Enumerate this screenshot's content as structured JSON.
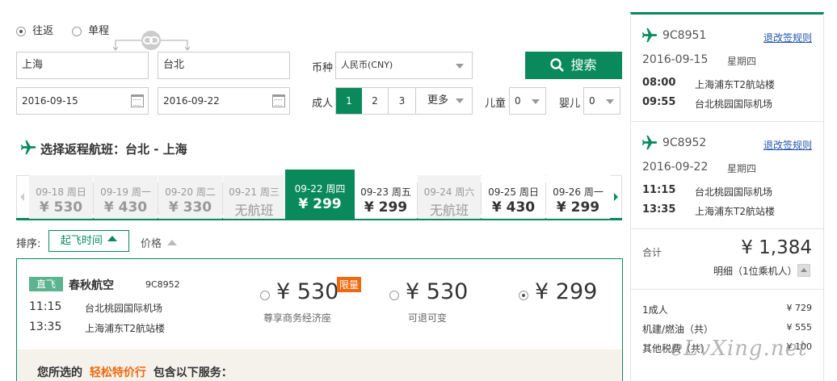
{
  "trip": {
    "roundtrip": "往返",
    "oneway": "单程"
  },
  "search": {
    "from": "上海",
    "to": "台北",
    "depart_date": "2016-09-15",
    "return_date": "2016-09-22",
    "currency_label": "币种",
    "currency": "人民币(CNY)",
    "adult_label": "成人",
    "adult_options": [
      "1",
      "2",
      "3"
    ],
    "more": "更多",
    "child_label": "儿童",
    "child_value": "0",
    "infant_label": "婴儿",
    "infant_value": "0",
    "search_button": "搜索"
  },
  "section_title": "选择返程航班：台北 - 上海",
  "date_tabs": [
    {
      "date": "09-18",
      "weekday": "周日",
      "price": "¥ 530",
      "state": "gray"
    },
    {
      "date": "09-19",
      "weekday": "周一",
      "price": "¥ 430",
      "state": "gray"
    },
    {
      "date": "09-20",
      "weekday": "周二",
      "price": "¥ 330",
      "state": "gray"
    },
    {
      "date": "09-21",
      "weekday": "周三",
      "price": "无航班",
      "state": "gray"
    },
    {
      "date": "09-22",
      "weekday": "周四",
      "price": "¥ 299",
      "state": "selected"
    },
    {
      "date": "09-23",
      "weekday": "周五",
      "price": "¥ 299",
      "state": "normal"
    },
    {
      "date": "09-24",
      "weekday": "周六",
      "price": "无航班",
      "state": "gray"
    },
    {
      "date": "09-25",
      "weekday": "周日",
      "price": "¥ 430",
      "state": "normal"
    },
    {
      "date": "09-26",
      "weekday": "周一",
      "price": "¥ 299",
      "state": "normal"
    }
  ],
  "sort": {
    "label": "排序:",
    "by_time": "起飞时间",
    "by_price": "价格"
  },
  "flight": {
    "tag": "直飞",
    "airline": "春秋航空",
    "number": "9C8952",
    "dep_time": "11:15",
    "dep_airport": "台北桃园国际机场",
    "arr_time": "13:35",
    "arr_airport": "上海浦东T2航站楼",
    "fares": [
      {
        "price": "¥ 530",
        "badge": "限量",
        "desc": "尊享商务经济座"
      },
      {
        "price": "¥ 530",
        "desc": "可退可变"
      },
      {
        "price": "¥ 299"
      }
    ],
    "services_prefix": "您所选的",
    "services_fare": "轻松特价行",
    "services_suffix": "包含以下服务："
  },
  "summary": {
    "rule_link": "退改签规则",
    "outbound": {
      "number": "9C8951",
      "date": "2016-09-15",
      "weekday": "星期四",
      "dep_time": "08:00",
      "dep_airport": "上海浦东T2航站楼",
      "arr_time": "09:55",
      "arr_airport": "台北桃园国际机场"
    },
    "return": {
      "number": "9C8952",
      "date": "2016-09-22",
      "weekday": "星期四",
      "dep_time": "11:15",
      "dep_airport": "台北桃园国际机场",
      "arr_time": "13:35",
      "arr_airport": "上海浦东T2航站楼"
    },
    "total_label": "合计",
    "total": "¥ 1,384",
    "detail": "明细（1位乘机人）",
    "lines": [
      {
        "label": "1成人",
        "value": "¥ 729"
      },
      {
        "label": "机建/燃油（共）",
        "value": "¥ 555"
      },
      {
        "label": "其他税费（共）",
        "value": "¥ 100"
      }
    ]
  },
  "watermark": "eLvXing.net",
  "colors": {
    "brand_green": "#0a8a5c",
    "badge_orange": "#ee6a11",
    "link_blue": "#2255aa"
  }
}
